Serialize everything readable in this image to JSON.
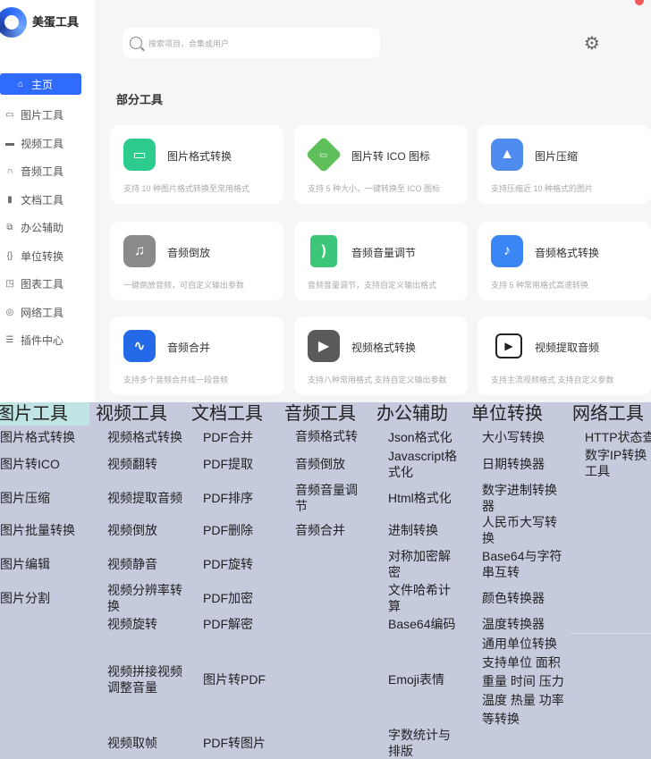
{
  "app": {
    "title": "美蛋工具",
    "search_placeholder": "搜索项目，合集或用户",
    "section_title": "部分工具",
    "accent": "#2f6bff"
  },
  "sidebar": {
    "items": [
      {
        "label": "主页",
        "icon": "home-icon",
        "active": true
      },
      {
        "label": "图片工具",
        "icon": "image-icon"
      },
      {
        "label": "视频工具",
        "icon": "video-icon"
      },
      {
        "label": "音频工具",
        "icon": "headphones-icon"
      },
      {
        "label": "文档工具",
        "icon": "document-icon"
      },
      {
        "label": "办公辅助",
        "icon": "copy-icon"
      },
      {
        "label": "单位转换",
        "icon": "braces-icon"
      },
      {
        "label": "图表工具",
        "icon": "chart-icon"
      },
      {
        "label": "网络工具",
        "icon": "globe-icon"
      },
      {
        "label": "插件中心",
        "icon": "sliders-icon"
      }
    ]
  },
  "cards": [
    {
      "name": "图片格式转换",
      "desc": "支持 10 种图片格式转换至常用格式",
      "icon": "image-format-icon",
      "color": "#2ecb8f"
    },
    {
      "name": "图片转 ICO 图标",
      "desc": "支持 5 种大小，一键转换至 ICO 图标",
      "icon": "ico-diamond-icon",
      "color": "#5fbf5a"
    },
    {
      "name": "图片压缩",
      "desc": "支持压缩近 10 种格式的图片",
      "icon": "image-compress-icon",
      "color": "#4f8cf0"
    },
    {
      "name": "音频倒放",
      "desc": "一键倒放音频，可自定义输出参数",
      "icon": "music-note-icon",
      "color": "#8a8a8a"
    },
    {
      "name": "音频音量调节",
      "desc": "音频音量调节，支持自定义输出格式",
      "icon": "audio-file-icon",
      "color": "#3cc67a"
    },
    {
      "name": "音频格式转换",
      "desc": "支持 5 种常用格式高速转换",
      "icon": "music-convert-icon",
      "color": "#3a86f5"
    },
    {
      "name": "音频合并",
      "desc": "支持多个音频合并成一段音频",
      "icon": "wave-merge-icon",
      "color": "#2469e8"
    },
    {
      "name": "视频格式转换",
      "desc": "支持八种常用格式 支持自定义输出参数",
      "icon": "video-play-icon",
      "color": "#5a5a5a"
    },
    {
      "name": "视频提取音频",
      "desc": "支持主流视频格式 支持自定义参数",
      "icon": "video-extract-icon",
      "color": "#222222"
    }
  ],
  "tools_table": {
    "headers": [
      "图片工具",
      "视频工具",
      "文档工具",
      "音频工具",
      "办公辅助",
      "单位转换",
      "网络工具"
    ],
    "columns": [
      [
        "图片格式转换",
        "图片转ICO",
        "图片压缩",
        "图片批量转换",
        "图片编辑",
        "图片分割"
      ],
      [
        "视频格式转换",
        "视频翻转",
        "视频提取音频",
        "视频倒放",
        "视频静音",
        "视频分辨率转换",
        "视频旋转",
        "视频拼接视频调整音量",
        "视频取帧"
      ],
      [
        "PDF合并",
        "PDF提取",
        "PDF排序",
        "PDF删除",
        "PDF旋转",
        "PDF加密",
        "PDF解密",
        "图片转PDF",
        "PDF转图片"
      ],
      [
        "音频格式转",
        "音频倒放",
        "音频音量调节",
        "音频合并"
      ],
      [
        "Json格式化",
        "Javascript格式化",
        "Html格式化",
        "进制转换",
        "对称加密解密",
        "文件哈希计算",
        "Base64编码",
        "Emoji表情",
        "字数统计与排版"
      ],
      [
        "大小写转换",
        "日期转换器",
        "数字进制转换器",
        "人民币大写转换",
        "Base64与字符串互转",
        "颜色转换器",
        "温度转换器",
        "通用单位转换支持单位 面积 重量 时间 压力 温度 热量 功率 等转换"
      ],
      [
        "HTTP状态查",
        "数字IP转换工具"
      ]
    ]
  }
}
